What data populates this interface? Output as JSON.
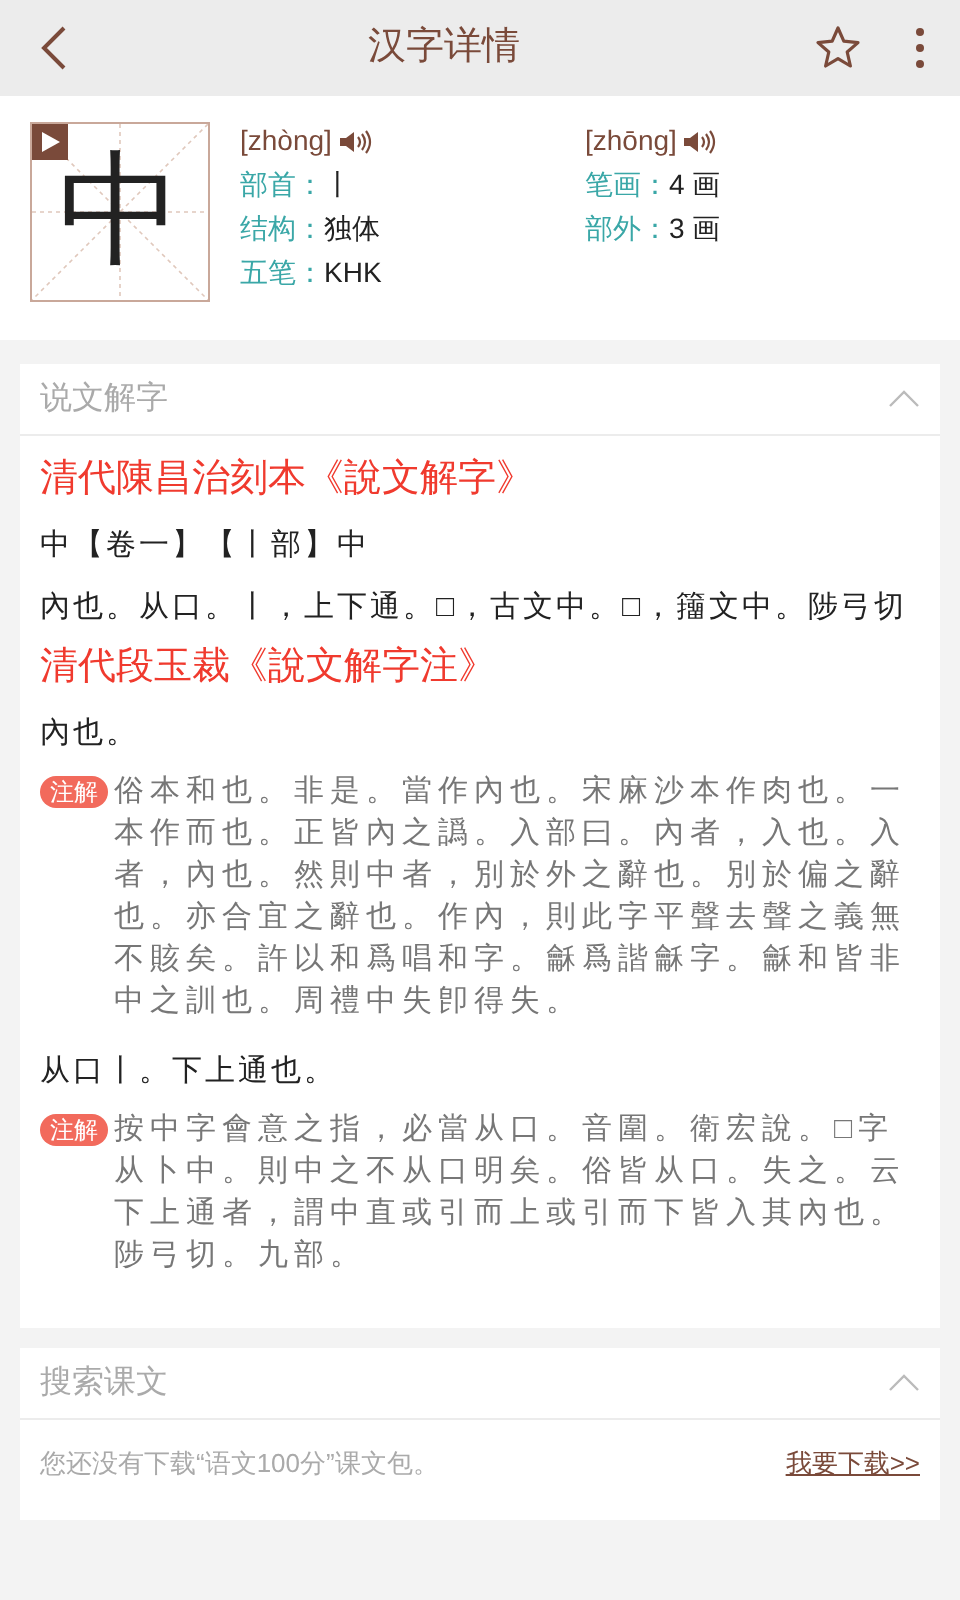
{
  "top_bar": {
    "title": "汉字详情",
    "favorited": false
  },
  "character": {
    "glyph": "中",
    "readings": [
      {
        "pinyin": "[zhòng]"
      },
      {
        "pinyin": "[zhōng]"
      }
    ],
    "fields": [
      {
        "label": "部首：",
        "value": "丨"
      },
      {
        "label": "笔画：",
        "value": "4 画"
      },
      {
        "label": "结构：",
        "value": "独体"
      },
      {
        "label": "部外：",
        "value": "3 画"
      },
      {
        "label": "五笔：",
        "value": "KHK"
      }
    ]
  },
  "sections": [
    {
      "title": "说文解字",
      "expanded": true,
      "blocks": [
        {
          "kind": "heading",
          "text": "清代陳昌治刻本《說文解字》"
        },
        {
          "kind": "text",
          "text": "中【卷一】【丨部】中"
        },
        {
          "kind": "text",
          "text": "內也。从口。丨，上下通。□，古文中。□，籒文中。陟弓切"
        },
        {
          "kind": "heading",
          "text": "清代段玉裁《說文解字注》"
        },
        {
          "kind": "text",
          "text": "內也。"
        },
        {
          "kind": "note",
          "badge": "注解",
          "text": "俗本和也。非是。當作內也。宋麻沙本作肉也。一本作而也。正皆內之譌。入部曰。內者，入也。入者，內也。然則中者，別於外之辭也。別於偏之辭也。亦合宜之辭也。作內，則此字平聲去聲之義無不賅矣。許以和爲唱和字。龢爲諧龢字。龢和皆非中之訓也。周禮中失卽得失。"
        },
        {
          "kind": "text",
          "text": "从口丨。下上通也。"
        },
        {
          "kind": "note",
          "badge": "注解",
          "text": "按中字會意之指，必當从口。音圍。衛宏說。□字从卜中。則中之不从口明矣。俗皆从口。失之。云下上通者，謂中直或引而上或引而下皆入其內也。陟弓切。九部。"
        }
      ]
    },
    {
      "title": "搜索课文",
      "expanded": true,
      "blocks": [
        {
          "kind": "download",
          "text": "您还没有下载“语文100分”课文包。",
          "link": "我要下载>>"
        }
      ]
    }
  ]
}
